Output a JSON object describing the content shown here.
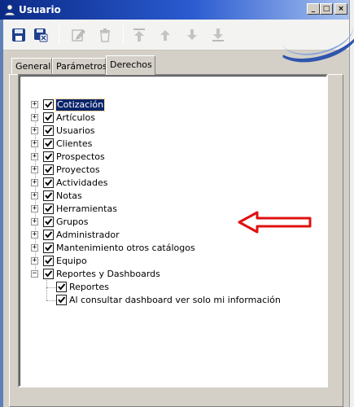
{
  "window": {
    "title": "Usuario",
    "controls": {
      "minimize": "_",
      "maximize": "□",
      "close": "×"
    }
  },
  "toolbar": {
    "icons": [
      "save-icon",
      "save-close-icon",
      "edit-icon",
      "delete-icon",
      "move-top-icon",
      "move-up-icon",
      "move-down-icon",
      "move-bottom-icon"
    ]
  },
  "tabs": [
    {
      "label": "General",
      "active": false
    },
    {
      "label": "Parámetros",
      "active": false
    },
    {
      "label": "Derechos",
      "active": true
    }
  ],
  "tree": {
    "items": [
      {
        "label": "Cotización",
        "checked": true,
        "expanded": false,
        "level": 0,
        "selected": true
      },
      {
        "label": "Artículos",
        "checked": true,
        "expanded": false,
        "level": 0
      },
      {
        "label": "Usuarios",
        "checked": true,
        "expanded": false,
        "level": 0
      },
      {
        "label": "Clientes",
        "checked": true,
        "expanded": false,
        "level": 0
      },
      {
        "label": "Prospectos",
        "checked": true,
        "expanded": false,
        "level": 0
      },
      {
        "label": "Proyectos",
        "checked": true,
        "expanded": false,
        "level": 0
      },
      {
        "label": "Actividades",
        "checked": true,
        "expanded": false,
        "level": 0
      },
      {
        "label": "Notas",
        "checked": true,
        "expanded": false,
        "level": 0
      },
      {
        "label": "Herramientas",
        "checked": true,
        "expanded": false,
        "level": 0
      },
      {
        "label": "Grupos",
        "checked": true,
        "expanded": false,
        "level": 0
      },
      {
        "label": "Administrador",
        "checked": true,
        "expanded": false,
        "level": 0
      },
      {
        "label": "Mantenimiento otros catálogos",
        "checked": true,
        "expanded": false,
        "level": 0
      },
      {
        "label": "Equipo",
        "checked": true,
        "expanded": false,
        "level": 0
      },
      {
        "label": "Reportes y Dashboards",
        "checked": true,
        "expanded": true,
        "level": 0
      },
      {
        "label": "Reportes",
        "checked": true,
        "level": 1
      },
      {
        "label": "Al consultar dashboard ver solo mi información",
        "checked": true,
        "level": 1
      }
    ]
  },
  "annotation": {
    "type": "red-arrow-pointing-left",
    "color": "#e01010"
  },
  "colors": {
    "titlebar_start": "#0b2a86",
    "titlebar_end": "#a7c1ef",
    "selection": "#0a246a"
  }
}
